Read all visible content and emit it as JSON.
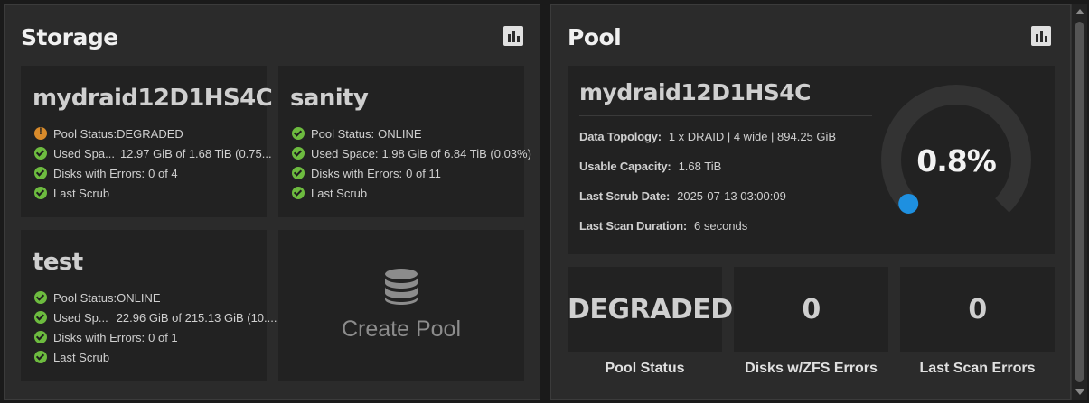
{
  "storage": {
    "title": "Storage",
    "chart_button_icon": "bar-chart-icon",
    "pools": [
      {
        "name": "mydraid12D1HS4C",
        "status_items": [
          {
            "icon": "warning-icon",
            "state": "warn",
            "label": "Pool Status:",
            "value": "DEGRADED"
          },
          {
            "icon": "check-circle-icon",
            "state": "ok",
            "label": "Used Spa...",
            "value": "12.97 GiB of 1.68 TiB (0.75..."
          },
          {
            "icon": "check-circle-icon",
            "state": "ok",
            "label": "Disks with Errors:",
            "value": "0 of 4"
          },
          {
            "icon": "check-circle-icon",
            "state": "ok",
            "label": "Last Scrub",
            "value": ""
          }
        ]
      },
      {
        "name": "sanity",
        "status_items": [
          {
            "icon": "check-circle-icon",
            "state": "ok",
            "label": "Pool Status:",
            "value": "ONLINE"
          },
          {
            "icon": "check-circle-icon",
            "state": "ok",
            "label": "Used Space:",
            "value": "1.98 GiB of 6.84 TiB (0.03%)"
          },
          {
            "icon": "check-circle-icon",
            "state": "ok",
            "label": "Disks with Errors:",
            "value": "0 of 11"
          },
          {
            "icon": "check-circle-icon",
            "state": "ok",
            "label": "Last Scrub",
            "value": ""
          }
        ]
      },
      {
        "name": "test",
        "status_items": [
          {
            "icon": "check-circle-icon",
            "state": "ok",
            "label": "Pool Status:",
            "value": "ONLINE"
          },
          {
            "icon": "check-circle-icon",
            "state": "ok",
            "label": "Used Sp...",
            "value": "22.96 GiB of 215.13 GiB (10...."
          },
          {
            "icon": "check-circle-icon",
            "state": "ok",
            "label": "Disks with Errors:",
            "value": "0 of 1"
          },
          {
            "icon": "check-circle-icon",
            "state": "ok",
            "label": "Last Scrub",
            "value": ""
          }
        ]
      }
    ],
    "create_pool": {
      "label": "Create Pool",
      "icon": "database-icon"
    }
  },
  "pool": {
    "title": "Pool",
    "chart_button_icon": "bar-chart-icon",
    "name": "mydraid12D1HS4C",
    "details": [
      {
        "key": "Data Topology:",
        "value": "1 x DRAID | 4 wide | 894.25 GiB"
      },
      {
        "key": "Usable Capacity:",
        "value": "1.68 TiB"
      },
      {
        "key": "Last Scrub Date:",
        "value": "2025-07-13 03:00:09"
      },
      {
        "key": "Last Scan Duration:",
        "value": "6 seconds"
      }
    ],
    "usage_gauge": {
      "display": "0.8%",
      "percent": 0.8,
      "track_color": "#333333",
      "fill_color": "#1e90e0"
    },
    "stats": [
      {
        "value": "DEGRADED",
        "label": "Pool Status"
      },
      {
        "value": "0",
        "label": "Disks w/ZFS Errors"
      },
      {
        "value": "0",
        "label": "Last Scan Errors"
      }
    ]
  },
  "colors": {
    "ok": "#6dbb3f",
    "warn": "#d98b2b",
    "panel_bg": "#2b2b2b",
    "card_bg": "#222222",
    "accent": "#1e90e0"
  }
}
